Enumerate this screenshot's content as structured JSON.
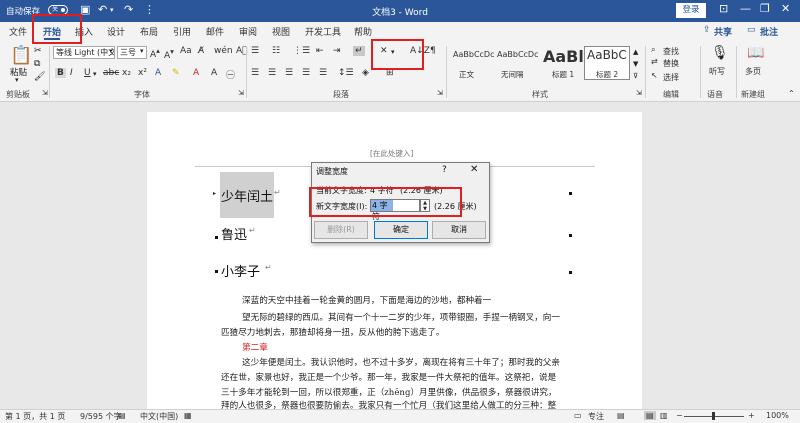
{
  "titlebar": {
    "autosave_label": "自动保存",
    "autosave_state": "关",
    "title": "文档3  -  Word",
    "login": "登录"
  },
  "tabs": [
    "文件",
    "开始",
    "插入",
    "设计",
    "布局",
    "引用",
    "邮件",
    "审阅",
    "视图",
    "开发工具",
    "帮助"
  ],
  "tab_active": "开始",
  "share": "共享",
  "comment": "批注",
  "ribbon": {
    "paste": "粘贴",
    "clipboard_group": "剪贴板",
    "font_name": "等线 Light (中文",
    "font_size": "三号",
    "font_group": "字体",
    "paragraph_group": "段落",
    "styles_group": "样式",
    "styles": [
      {
        "sample": "AaBbCcDc",
        "name": "正文"
      },
      {
        "sample": "AaBbCcDc",
        "name": "无间隔"
      },
      {
        "sample": "AaBl",
        "name": "标题 1"
      },
      {
        "sample": "AaBbC",
        "name": "标题 2"
      }
    ],
    "find": "查找",
    "replace": "替换",
    "select": "选择",
    "editing_group": "编辑",
    "dictate": "听写",
    "voice_group": "语音",
    "multipage": "多页",
    "newgroup": "新建组"
  },
  "document": {
    "header_placeholder": "[在此处键入]",
    "headings": [
      "少年闰土",
      "鲁迅",
      "小李子"
    ],
    "body": [
      "深蓝的天空中挂着一轮金黄的圆月，下面是海边的沙地，都种着一",
      "望无际的碧绿的西瓜。其间有一个十一二岁的少年，项带银圈，手捏一柄钢叉，向一",
      "匹猹尽力地刺去，那猹却将身一扭，反从他的胯下逃走了。",
      "第二章",
      "这少年便是闰土。我认识他时，也不过十多岁，离现在将有三十年了；那时我的父亲",
      "还在世，家景也好，我正是一个少爷。那一年，我家是一件大祭祀的值年。这祭祀，说是",
      "三十多年才能轮到一回，所以很郑重，正（zhēng）月里供像，供品很多，祭器很讲究，",
      "拜的人也很多，祭器也很要防偷去。我家只有一个忙月（我们这里给人做工的分三种：整"
    ]
  },
  "dialog": {
    "title": "调整宽度",
    "help": "?",
    "current_label": "当前文字宽度:",
    "current_value": "4 字符",
    "current_cm": "(2.26 厘米)",
    "new_label": "新文字宽度(I):",
    "new_value": "4 字符",
    "new_cm": "(2.26 厘米)",
    "delete_btn": "删除(R)",
    "ok_btn": "确定",
    "cancel_btn": "取消"
  },
  "statusbar": {
    "page": "第 1 页，共 1 页",
    "words": "9/595 个字",
    "language": "中文(中国)",
    "focus": "专注",
    "zoom": "100%"
  },
  "colors": {
    "brand": "#2b579a",
    "highlight": "#e02020"
  }
}
